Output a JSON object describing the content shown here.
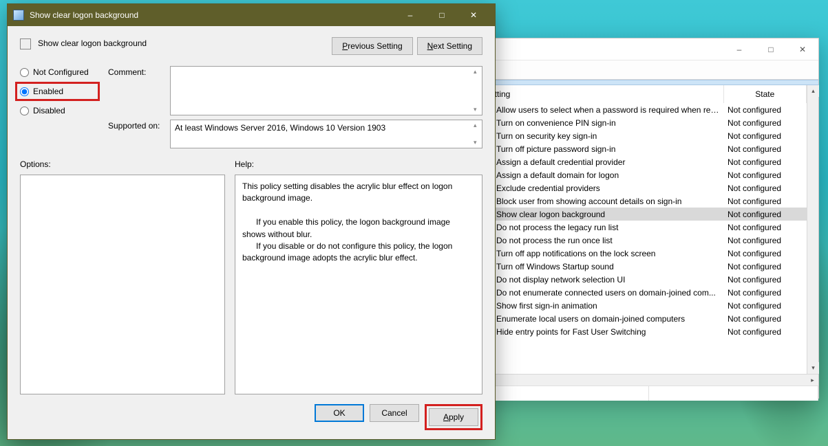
{
  "dialog": {
    "title": "Show clear logon background",
    "header": "Show clear logon background",
    "prev_btn": "Previous Setting",
    "next_btn": "Next Setting",
    "radios": {
      "not_configured": "Not Configured",
      "enabled": "Enabled",
      "disabled": "Disabled"
    },
    "selected_radio": "enabled",
    "comment_label": "Comment:",
    "comment_value": "",
    "supported_label": "Supported on:",
    "supported_value": "At least Windows Server 2016, Windows 10 Version 1903",
    "options_label": "Options:",
    "options_value": "",
    "help_label": "Help:",
    "help_text": "This policy setting disables the acrylic blur effect on logon background image.\n\n      If you enable this policy, the logon background image shows without blur.\n      If you disable or do not configure this policy, the logon background image adopts the acrylic blur effect.",
    "ok": "OK",
    "cancel": "Cancel",
    "apply": "Apply"
  },
  "list": {
    "col_setting": "Setting",
    "col_state": "State",
    "rows": [
      {
        "name": "Allow users to select when a password is required when resu...",
        "state": "Not configured"
      },
      {
        "name": "Turn on convenience PIN sign-in",
        "state": "Not configured"
      },
      {
        "name": "Turn on security key sign-in",
        "state": "Not configured"
      },
      {
        "name": "Turn off picture password sign-in",
        "state": "Not configured"
      },
      {
        "name": "Assign a default credential provider",
        "state": "Not configured"
      },
      {
        "name": "Assign a default domain for logon",
        "state": "Not configured"
      },
      {
        "name": "Exclude credential providers",
        "state": "Not configured"
      },
      {
        "name": "Block user from showing account details on sign-in",
        "state": "Not configured"
      },
      {
        "name": "Show clear logon background",
        "state": "Not configured",
        "selected": true
      },
      {
        "name": "Do not process the legacy run list",
        "state": "Not configured"
      },
      {
        "name": "Do not process the run once list",
        "state": "Not configured"
      },
      {
        "name": "Turn off app notifications on the lock screen",
        "state": "Not configured"
      },
      {
        "name": "Turn off Windows Startup sound",
        "state": "Not configured"
      },
      {
        "name": "Do not display network selection UI",
        "state": "Not configured"
      },
      {
        "name": "Do not enumerate connected users on domain-joined com...",
        "state": "Not configured"
      },
      {
        "name": "Show first sign-in animation",
        "state": "Not configured"
      },
      {
        "name": "Enumerate local users on domain-joined computers",
        "state": "Not configured"
      },
      {
        "name": "Hide entry points for Fast User Switching",
        "state": "Not configured"
      }
    ]
  }
}
